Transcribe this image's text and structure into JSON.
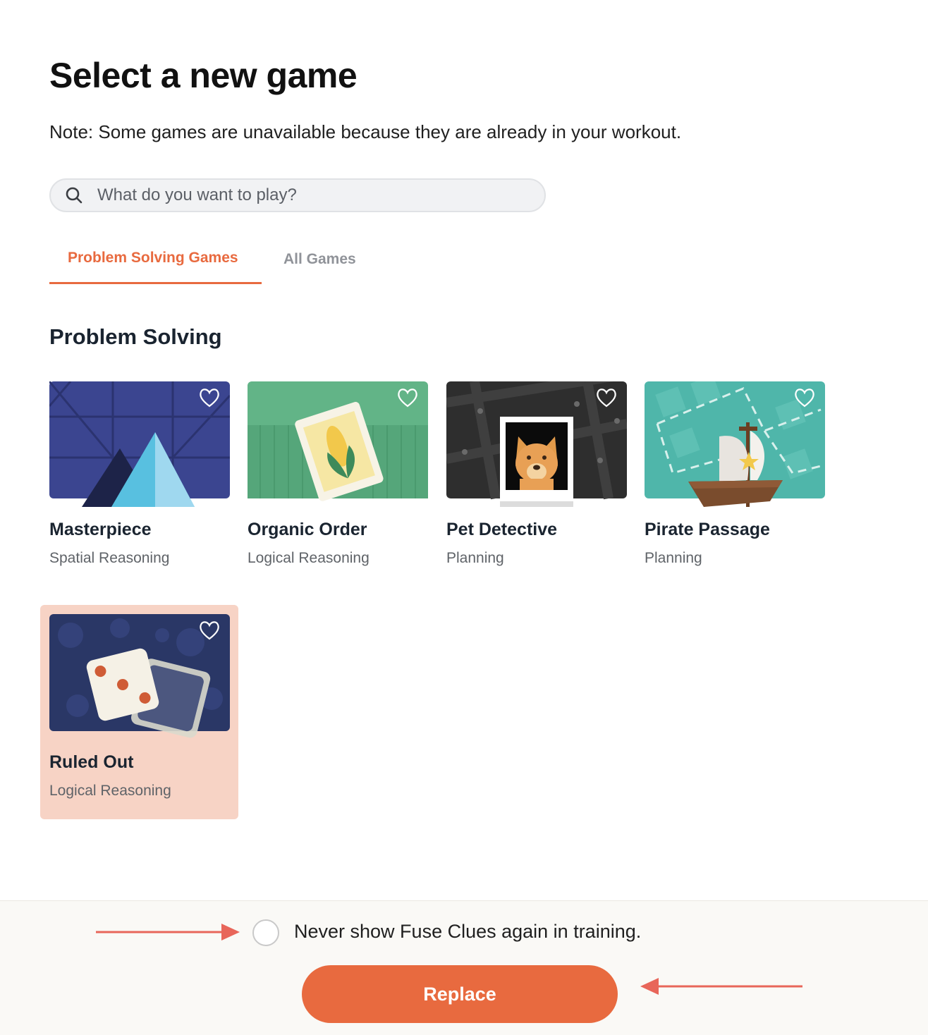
{
  "header": {
    "title": "Select a new game",
    "note": "Note: Some games are unavailable because they are already in your workout."
  },
  "search": {
    "placeholder": "What do you want to play?",
    "icon": "search-icon"
  },
  "tabs": [
    {
      "label": "Problem Solving Games",
      "active": true
    },
    {
      "label": "All Games",
      "active": false
    }
  ],
  "section": {
    "title": "Problem Solving"
  },
  "games": [
    {
      "name": "Masterpiece",
      "category": "Spatial Reasoning",
      "selected": false
    },
    {
      "name": "Organic Order",
      "category": "Logical Reasoning",
      "selected": false
    },
    {
      "name": "Pet Detective",
      "category": "Planning",
      "selected": false
    },
    {
      "name": "Pirate Passage",
      "category": "Planning",
      "selected": false
    },
    {
      "name": "Ruled Out",
      "category": "Logical Reasoning",
      "selected": true
    }
  ],
  "footer": {
    "checkbox_label": "Never show Fuse Clues again in training.",
    "checkbox_checked": false,
    "replace_label": "Replace"
  },
  "colors": {
    "accent": "#e86a3f",
    "selected_card": "#f7d3c5",
    "arrow": "#e8665a"
  }
}
